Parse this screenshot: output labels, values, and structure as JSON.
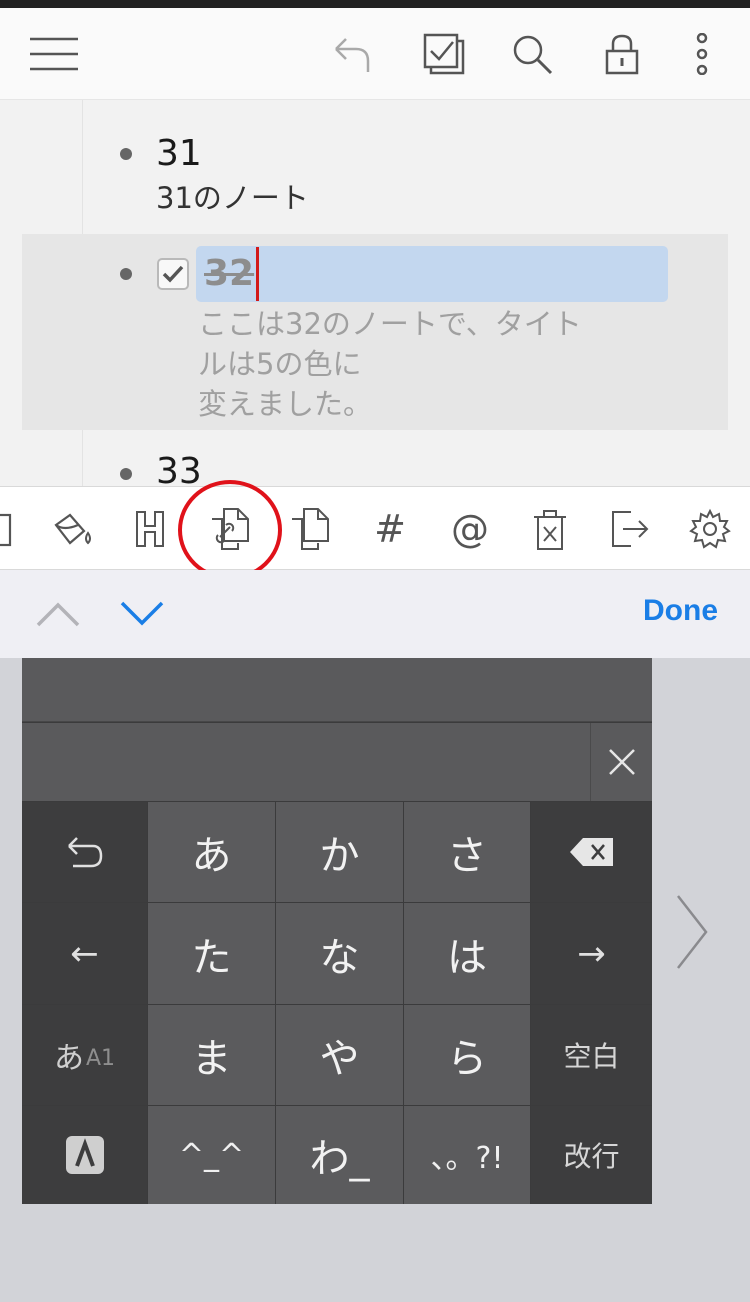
{
  "toolbar": {
    "icons": [
      "menu-icon",
      "undo-icon",
      "checkbox-icon",
      "search-icon",
      "lock-icon",
      "more-vertical-icon"
    ]
  },
  "outline": {
    "items": [
      {
        "title": "31",
        "note": "31のノート",
        "checked": false
      },
      {
        "title": "32",
        "note": "ここは32のノートで、タイト\nルは5の色に\n変えました。",
        "checked": true,
        "selected": true
      },
      {
        "title": "33",
        "note": "",
        "checked": false
      }
    ]
  },
  "tool_row": {
    "icons": [
      "panel-icon",
      "paint-bucket-icon",
      "heading-icon",
      "link-copy-icon",
      "copy-icon",
      "hashtag-icon",
      "mention-icon",
      "delete-icon",
      "export-icon",
      "settings-icon"
    ],
    "hash_text": "#",
    "at_text": "@",
    "highlight_color": "#e0121a"
  },
  "accessory": {
    "done_label": "Done",
    "done_color": "#1a7ee6"
  },
  "keyboard": {
    "kana_rows": [
      [
        "あ",
        "か",
        "さ"
      ],
      [
        "た",
        "な",
        "は"
      ],
      [
        "ま",
        "や",
        "ら"
      ],
      [
        "^_^",
        "わ_",
        "、。?!"
      ]
    ],
    "mode_label_kana": "あ",
    "mode_label_alpha": "A1",
    "space_label": "空白",
    "return_label": "改行",
    "left_arrow": "←",
    "right_arrow": "→"
  }
}
